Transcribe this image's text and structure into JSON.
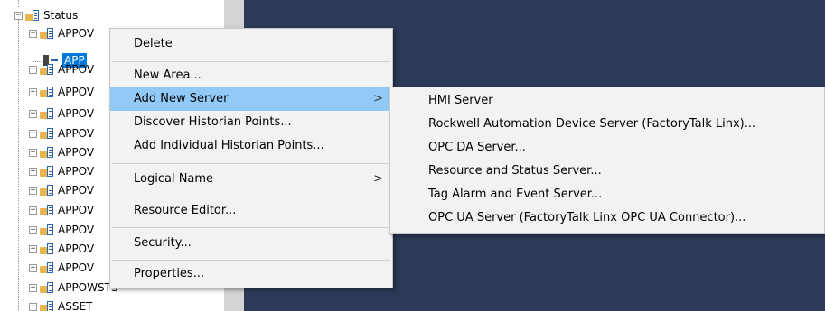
{
  "tree": {
    "root_label": "Status",
    "expanded_label": "APPOV",
    "selected_label": "APP",
    "rows": [
      "APPOV",
      "APPOV",
      "APPOV",
      "APPOV",
      "APPOV",
      "APPOV",
      "APPOV",
      "APPOV",
      "APPOV",
      "APPOV"
    ],
    "partial_row": "APPOWSTS",
    "bottom_row": "ASSET",
    "collapse_glyph": "−",
    "expand_glyph": "+"
  },
  "context_menu": {
    "items": [
      {
        "label": "Delete"
      },
      {
        "label": "New Area..."
      },
      {
        "label": "Add New Server",
        "arrow": ">"
      },
      {
        "label": "Discover Historian Points..."
      },
      {
        "label": "Add Individual Historian Points..."
      },
      {
        "label": "Logical Name",
        "arrow": ">"
      },
      {
        "label": "Resource Editor..."
      },
      {
        "label": "Security..."
      },
      {
        "label": "Properties..."
      }
    ],
    "highlighted": "Add New Server"
  },
  "submenu": {
    "items": [
      {
        "label": "HMI Server"
      },
      {
        "label": "Rockwell Automation Device Server (FactoryTalk Linx)..."
      },
      {
        "label": "OPC DA Server..."
      },
      {
        "label": "Resource and Status Server..."
      },
      {
        "label": "Tag Alarm and Event Server..."
      },
      {
        "label": "OPC UA Server (FactoryTalk Linx OPC UA Connector)..."
      }
    ]
  },
  "colors": {
    "dark_pane": "#2c3a57",
    "highlight": "#91c9f7",
    "selection": "#0078d7",
    "menu_bg": "#f2f2f2"
  }
}
